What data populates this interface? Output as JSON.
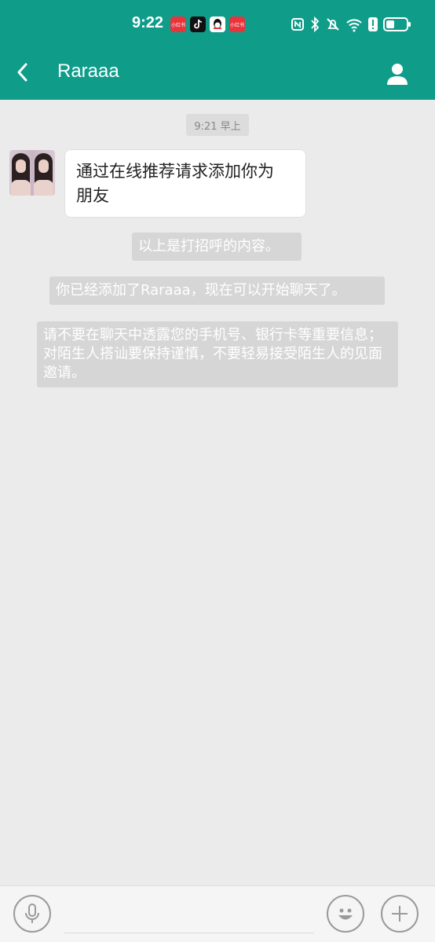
{
  "status_bar": {
    "time": "9:22",
    "badge_text": "小红书"
  },
  "header": {
    "title": "Raraaa"
  },
  "chat": {
    "timestamp": "9:21 早上",
    "incoming_message_line1": "通过在线推荐请求添加你为",
    "incoming_message_line2": "朋友",
    "system_messages": [
      "以上是打招呼的内容。",
      "你已经添加了Raraaa，现在可以开始聊天了。",
      "请不要在聊天中透露您的手机号、银行卡等重要信息；对陌生人搭讪要保持谨慎，不要轻易接受陌生人的见面邀请。"
    ]
  },
  "colors": {
    "header": "#0f9d8a",
    "background": "#ebebeb",
    "system_chip": "#d6d6d6"
  },
  "icons": [
    "back-arrow-icon",
    "person-icon",
    "microphone-icon",
    "smiley-icon",
    "plus-icon",
    "nfc-icon",
    "bluetooth-icon",
    "mute-icon",
    "wifi-icon",
    "alert-icon",
    "battery-icon"
  ]
}
